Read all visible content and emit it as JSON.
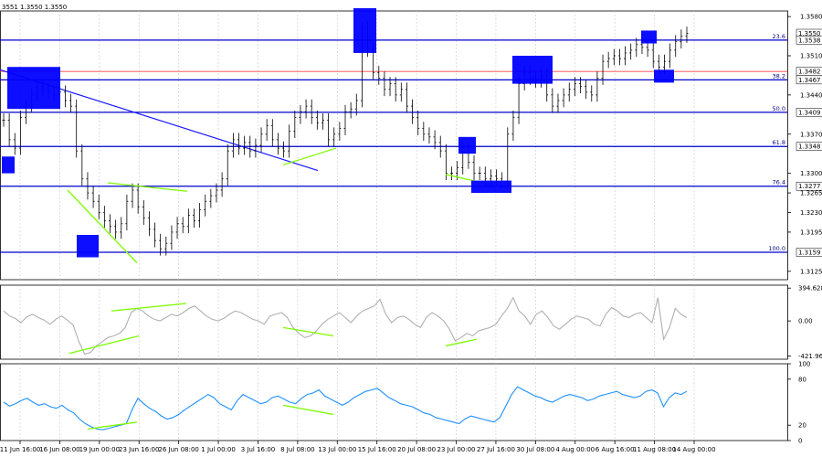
{
  "header": {
    "ohlc_text": "3551 1.3550 1.3550"
  },
  "chart_data": {
    "type": "line",
    "panels": [
      {
        "name": "price",
        "y_ticks": [
          "1.3580",
          "1.3510",
          "1.3440",
          "1.3370",
          "1.3300",
          "1.3265",
          "1.3230",
          "1.3195",
          "1.3125"
        ],
        "y_range": [
          1.311,
          1.359
        ],
        "series": [
          {
            "values": [
              1.3395,
              1.336,
              1.3345,
              1.34,
              1.342,
              1.344,
              1.3455,
              1.345,
              1.3445,
              1.344,
              1.3445,
              1.343,
              1.342,
              1.334,
              1.329,
              1.3265,
              1.325,
              1.323,
              1.3215,
              1.3205,
              1.3195,
              1.321,
              1.325,
              1.327,
              1.324,
              1.322,
              1.32,
              1.318,
              1.3165,
              1.3175,
              1.3195,
              1.321,
              1.3205,
              1.3225,
              1.3215,
              1.3235,
              1.325,
              1.326,
              1.327,
              1.329,
              1.334,
              1.336,
              1.3345,
              1.3355,
              1.334,
              1.335,
              1.337,
              1.3385,
              1.336,
              1.3345,
              1.334,
              1.3375,
              1.34,
              1.341,
              1.342,
              1.34,
              1.339,
              1.3395,
              1.336,
              1.337,
              1.338,
              1.341,
              1.3415,
              1.343,
              1.356,
              1.352,
              1.348,
              1.347,
              1.345,
              1.346,
              1.344,
              1.345,
              1.342,
              1.34,
              1.338,
              1.337,
              1.3365,
              1.3355,
              1.334,
              1.33,
              1.33,
              1.331,
              1.3345,
              1.332,
              1.33,
              1.33,
              1.329,
              1.3295,
              1.329,
              1.3285,
              1.337,
              1.34,
              1.346,
              1.348,
              1.347,
              1.3465,
              1.3475,
              1.344,
              1.342,
              1.343,
              1.344,
              1.345,
              1.346,
              1.3455,
              1.3445,
              1.344,
              1.347,
              1.35,
              1.3505,
              1.351,
              1.3505,
              1.3515,
              1.352,
              1.353,
              1.3525,
              1.352,
              1.35,
              1.349,
              1.35,
              1.352,
              1.3535,
              1.3545,
              1.355
            ]
          }
        ],
        "levels": [
          {
            "value": 1.3538,
            "label": "23.6"
          },
          {
            "value": 1.3467,
            "label": "38.2"
          },
          {
            "value": 1.3409,
            "label": "50.0"
          },
          {
            "value": 1.3348,
            "label": "61.8"
          },
          {
            "value": 1.3277,
            "label": "76.4"
          },
          {
            "value": 1.3159,
            "label": "100.0"
          }
        ],
        "tags": [
          {
            "value": 1.355,
            "text": "1.3550",
            "color": "#ffffff"
          },
          {
            "value": 1.3538,
            "text": "1.3538",
            "color": "#ffffff"
          },
          {
            "value": 1.3482,
            "text": "1.3482",
            "color": "#ffffff"
          },
          {
            "value": 1.3467,
            "text": "1.3467",
            "color": "#ffffff"
          },
          {
            "value": 1.3409,
            "text": "1.3409",
            "color": "#ffffff"
          },
          {
            "value": 1.3348,
            "text": "1.3348",
            "color": "#ffffff"
          },
          {
            "value": 1.3277,
            "text": "1.3277",
            "color": "#ffffff"
          },
          {
            "value": 1.3159,
            "text": "1.3159",
            "color": "#ffffff"
          }
        ]
      },
      {
        "name": "oscillator-1",
        "y_ticks": [
          "394.6289",
          "0.00",
          "-421.9616"
        ],
        "y_range": [
          -460,
          430
        ],
        "series": [
          {
            "values": [
              120,
              60,
              30,
              -20,
              50,
              80,
              40,
              10,
              -40,
              20,
              60,
              10,
              -50,
              -250,
              -400,
              -380,
              -300,
              -250,
              -200,
              -180,
              -150,
              -80,
              100,
              150,
              120,
              60,
              20,
              0,
              40,
              80,
              60,
              100,
              150,
              180,
              120,
              60,
              20,
              0,
              30,
              80,
              120,
              100,
              60,
              20,
              0,
              -40,
              60,
              80,
              100,
              40,
              -80,
              -150,
              -200,
              -180,
              -120,
              -40,
              20,
              60,
              100,
              40,
              -20,
              60,
              120,
              150,
              180,
              260,
              80,
              -20,
              40,
              60,
              20,
              -40,
              -80,
              40,
              100,
              60,
              0,
              -100,
              -240,
              -200,
              -150,
              -180,
              -120,
              -100,
              -80,
              -40,
              60,
              150,
              280,
              120,
              60,
              -40,
              80,
              120,
              40,
              -60,
              -100,
              -40,
              20,
              60,
              40,
              20,
              -40,
              -60,
              80,
              160,
              120,
              60,
              40,
              80,
              100,
              40,
              -20,
              280,
              -220,
              -80,
              150,
              80,
              40
            ]
          }
        ]
      },
      {
        "name": "oscillator-2",
        "y_ticks": [
          "100",
          "80",
          "20",
          "0"
        ],
        "y_range": [
          0,
          100
        ],
        "series": [
          {
            "values": [
              50,
              45,
              48,
              52,
              55,
              50,
              46,
              48,
              44,
              42,
              46,
              40,
              36,
              28,
              22,
              18,
              15,
              14,
              16,
              18,
              20,
              22,
              40,
              55,
              48,
              42,
              38,
              32,
              28,
              30,
              34,
              40,
              45,
              50,
              55,
              60,
              56,
              48,
              44,
              40,
              52,
              60,
              56,
              52,
              48,
              50,
              56,
              58,
              54,
              50,
              48,
              55,
              60,
              62,
              66,
              58,
              54,
              50,
              46,
              50,
              56,
              60,
              64,
              66,
              68,
              62,
              56,
              52,
              48,
              46,
              44,
              40,
              36,
              34,
              30,
              28,
              26,
              24,
              22,
              28,
              32,
              30,
              28,
              26,
              24,
              30,
              45,
              60,
              70,
              66,
              62,
              58,
              56,
              52,
              50,
              54,
              58,
              60,
              58,
              56,
              52,
              54,
              58,
              60,
              62,
              64,
              60,
              58,
              56,
              58,
              64,
              66,
              62,
              44,
              56,
              62,
              60,
              64
            ]
          }
        ]
      }
    ],
    "x_labels": [
      "11 Jun 16:00",
      "16 Jun 08:00",
      "19 Jun 00:00",
      "23 Jun 16:00",
      "26 Jun 08:00",
      "1 Jul 00:00",
      "3 Jul 16:00",
      "8 Jul 08:00",
      "13 Jul 00:00",
      "15 Jul 16:00",
      "20 Jul 08:00",
      "23 Jul 00:00",
      "27 Jul 16:00",
      "30 Jul 08:00",
      "4 Aug 00:00",
      "6 Aug 16:00",
      "11 Aug 08:00",
      "14 Aug 00:00"
    ],
    "colors": {
      "levels": "#0000cc",
      "trendline": "#1a1aff",
      "divergence": "#7cfc00",
      "marker_box": "#0000ff",
      "red_line": "#ff4040",
      "price": "#000000",
      "osc1": "#b0b0b0",
      "osc2": "#1e90ff",
      "grid": "#c8c8c8"
    }
  }
}
